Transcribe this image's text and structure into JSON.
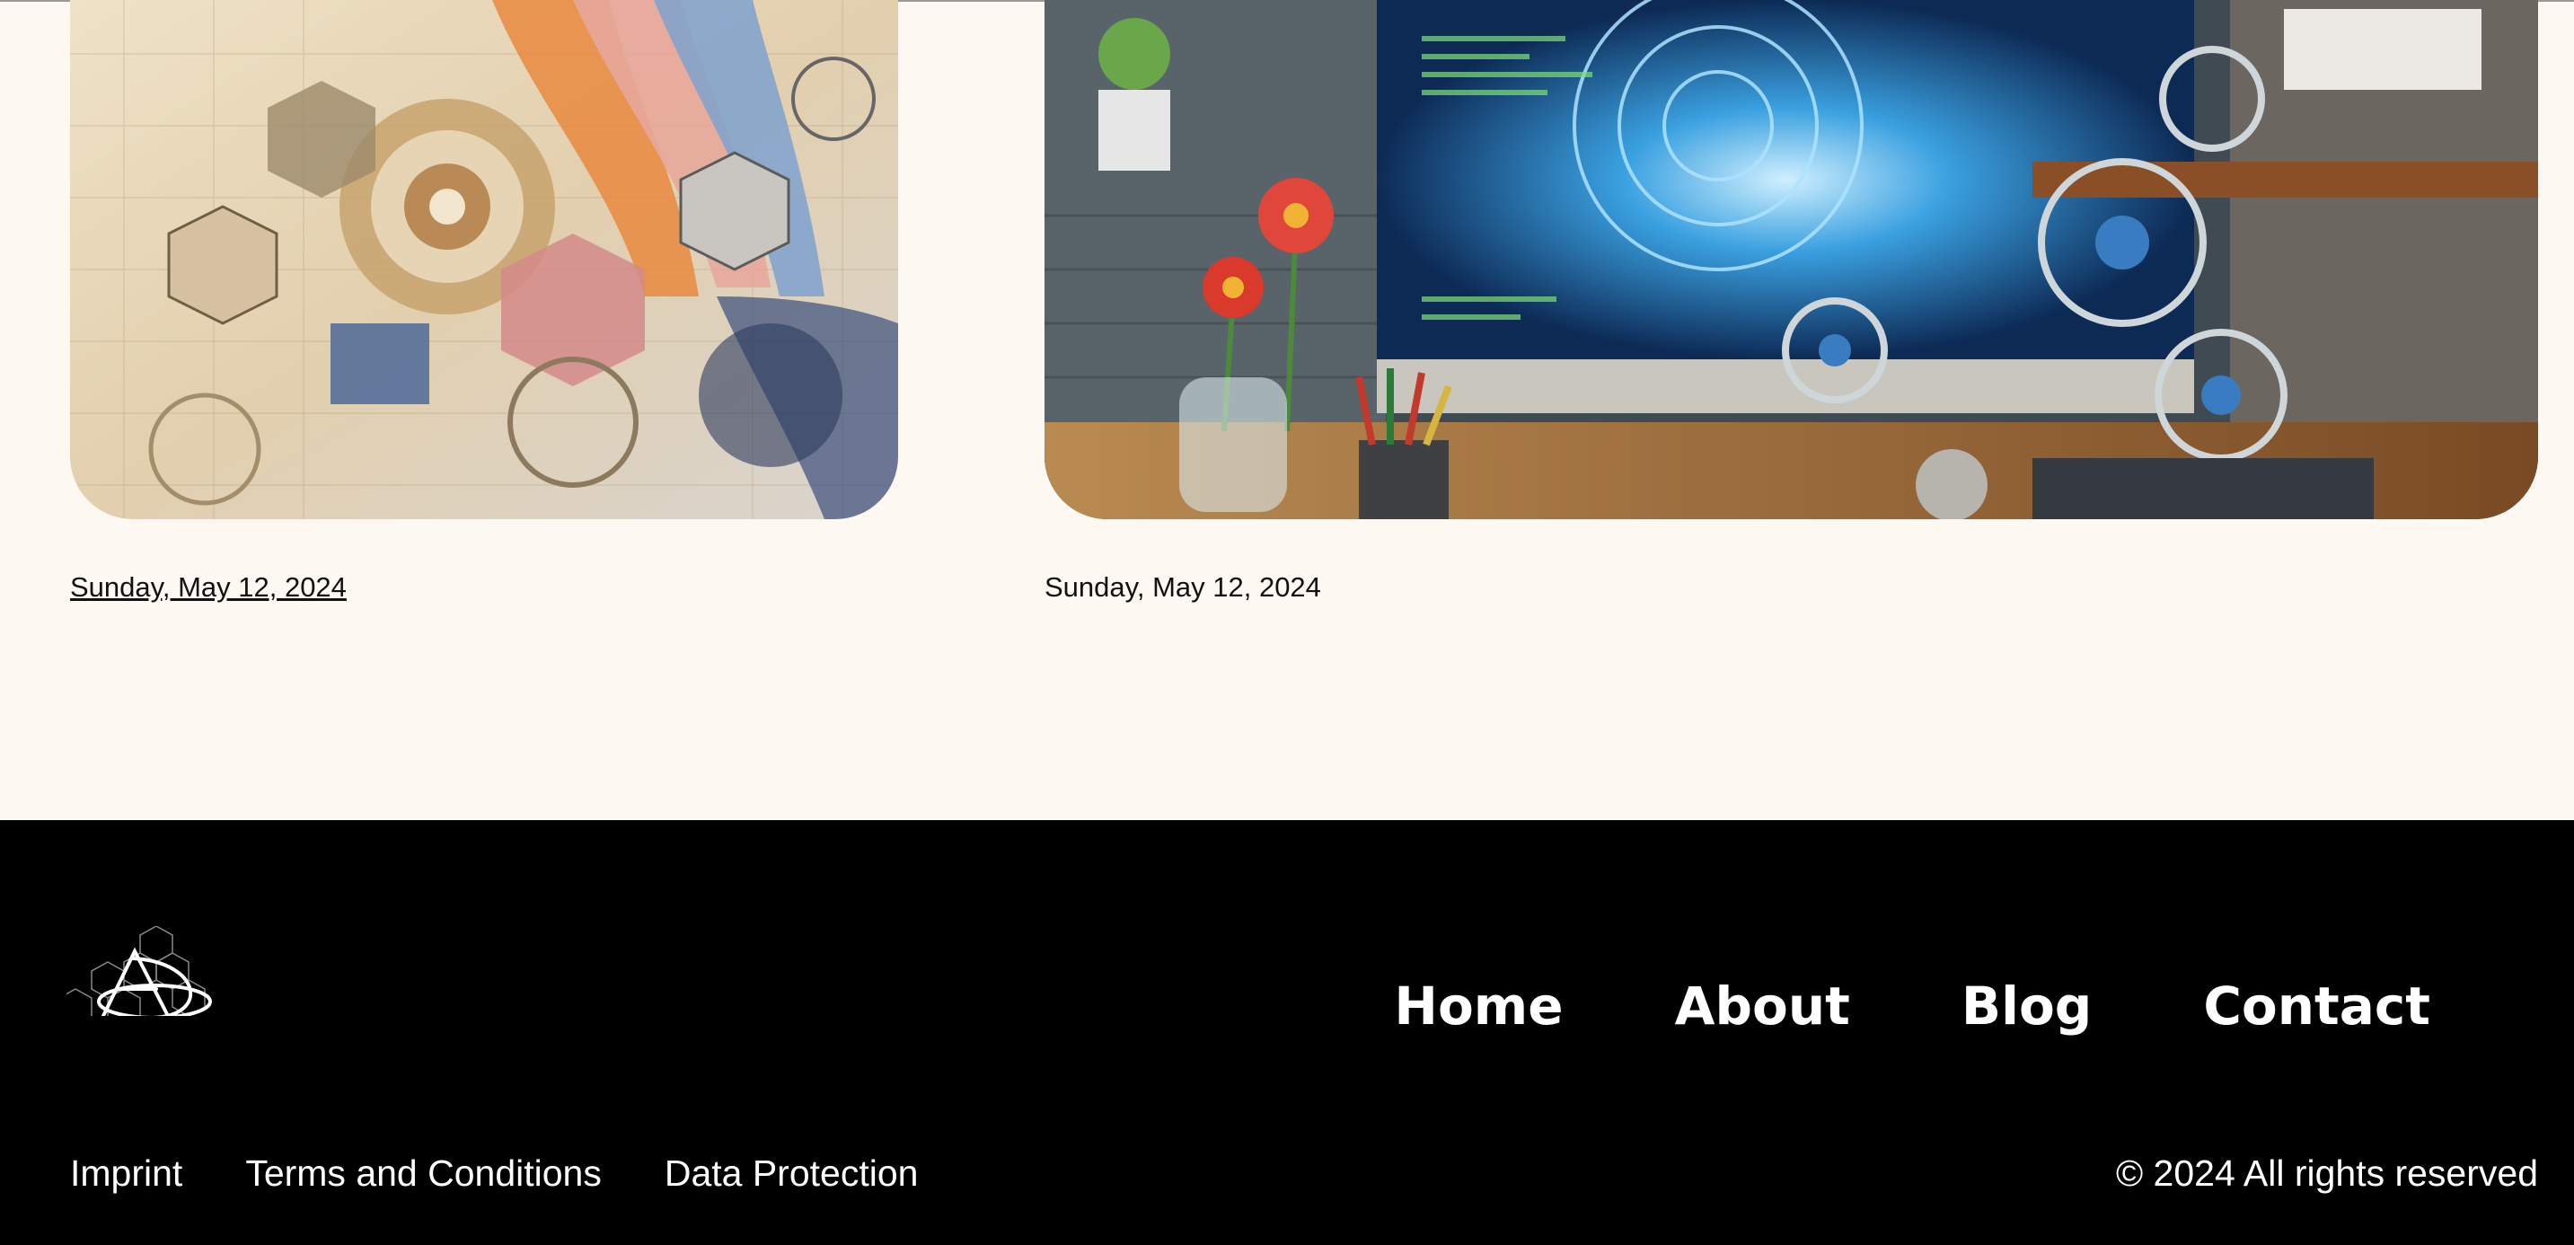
{
  "posts": [
    {
      "date": "Sunday, May 12, 2024",
      "image_icon": "abstract-geometric-artwork-image"
    },
    {
      "date": "Sunday, May 12, 2024",
      "image_icon": "tech-desk-illustration-image"
    }
  ],
  "footer": {
    "logo_icon": "hexagon-ad-monogram-logo",
    "nav": {
      "home": "Home",
      "about": "About",
      "blog": "Blog",
      "contact": "Contact"
    },
    "legal": {
      "imprint": "Imprint",
      "terms": "Terms and Conditions",
      "privacy": "Data Protection"
    },
    "copyright": "© 2024 All rights reserved"
  },
  "colors": {
    "page_bg": "#fdf9f2",
    "footer_bg": "#000000",
    "footer_text": "#ffffff"
  }
}
